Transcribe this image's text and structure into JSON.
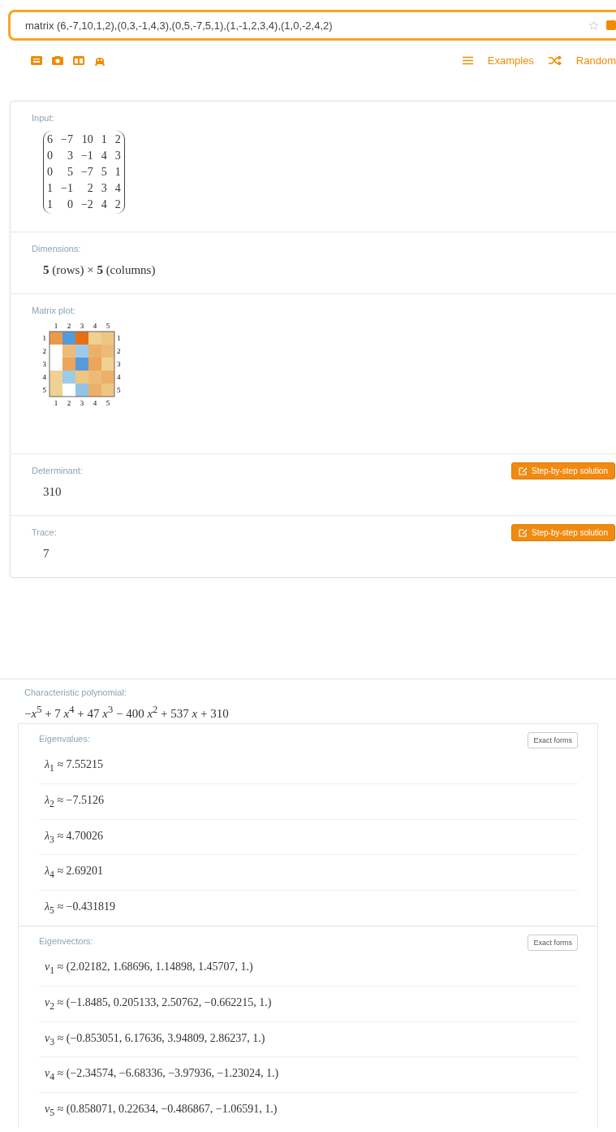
{
  "search": {
    "value": "matrix (6,-7,10,1,2),(0,3,-1,4,3),(0,5,-7,5,1),(1,-1,2,3,4),(1,0,-2,4,2)"
  },
  "links": [
    {
      "kind": "examples",
      "label": "Examples"
    },
    {
      "kind": "random",
      "label": "Random"
    }
  ],
  "pods": [
    {
      "kind": "matrix",
      "title": "Input:",
      "rows": [
        [
          "6",
          "−7",
          "10",
          "1",
          "2"
        ],
        [
          "0",
          "3",
          "−1",
          "4",
          "3"
        ],
        [
          "0",
          "5",
          "−7",
          "5",
          "1"
        ],
        [
          "1",
          "−1",
          "2",
          "3",
          "4"
        ],
        [
          "1",
          "0",
          "−2",
          "4",
          "2"
        ]
      ]
    },
    {
      "kind": "text",
      "title": "Dimensions:",
      "value": "**5** (rows) × **5** (columns)"
    },
    {
      "kind": "plot",
      "title": "Matrix plot:",
      "top_labels": [
        "1",
        "2",
        "3",
        "4",
        "5"
      ],
      "bottom_labels": [
        "1",
        "2",
        "3",
        "4",
        "5"
      ],
      "left_labels": [
        "1",
        "2",
        "3",
        "4",
        "5"
      ],
      "right_labels": [
        "1",
        "2",
        "3",
        "4",
        "5"
      ]
    },
    {
      "kind": "text",
      "title": "Determinant:",
      "value": "310",
      "button": "Step-by-step solution"
    },
    {
      "kind": "text",
      "title": "Trace:",
      "value": "7",
      "button": "Step-by-step solution"
    }
  ],
  "characteristic_polynomial": {
    "title": "Characteristic polynomial:",
    "value": "−*x*$^{5}$ + 7 *x*$^{4}$ + 47 *x*$^{3}$ − 400 *x*$^{2}$ + 537 *x* + 310"
  },
  "eigen_pods": [
    {
      "title": "Eigenvalues:",
      "button": "Exact forms",
      "items": [
        "*λ*$_{1}$ ≈ 7.55215",
        "*λ*$_{2}$ ≈ −7.5126",
        "*λ*$_{3}$ ≈ 4.70026",
        "*λ*$_{4}$ ≈ 2.69201",
        "*λ*$_{5}$ ≈ −0.431819"
      ]
    },
    {
      "title": "Eigenvectors:",
      "button": "Exact forms",
      "items": [
        "*v*$_{1}$ ≈ (2.02182, 1.68696, 1.14898, 1.45707, 1.)",
        "*v*$_{2}$ ≈ (−1.8485, 0.205133, 2.50762, −0.662215, 1.)",
        "*v*$_{3}$ ≈ (−0.853051, 6.17636, 3.94809, 2.86237, 1.)",
        "*v*$_{4}$ ≈ (−2.34574, −6.68336, −3.97936, −1.23024, 1.)",
        "*v*$_{5}$ ≈ (0.858071, 0.22634, −0.486867, −1.06591, 1.)"
      ]
    }
  ]
}
